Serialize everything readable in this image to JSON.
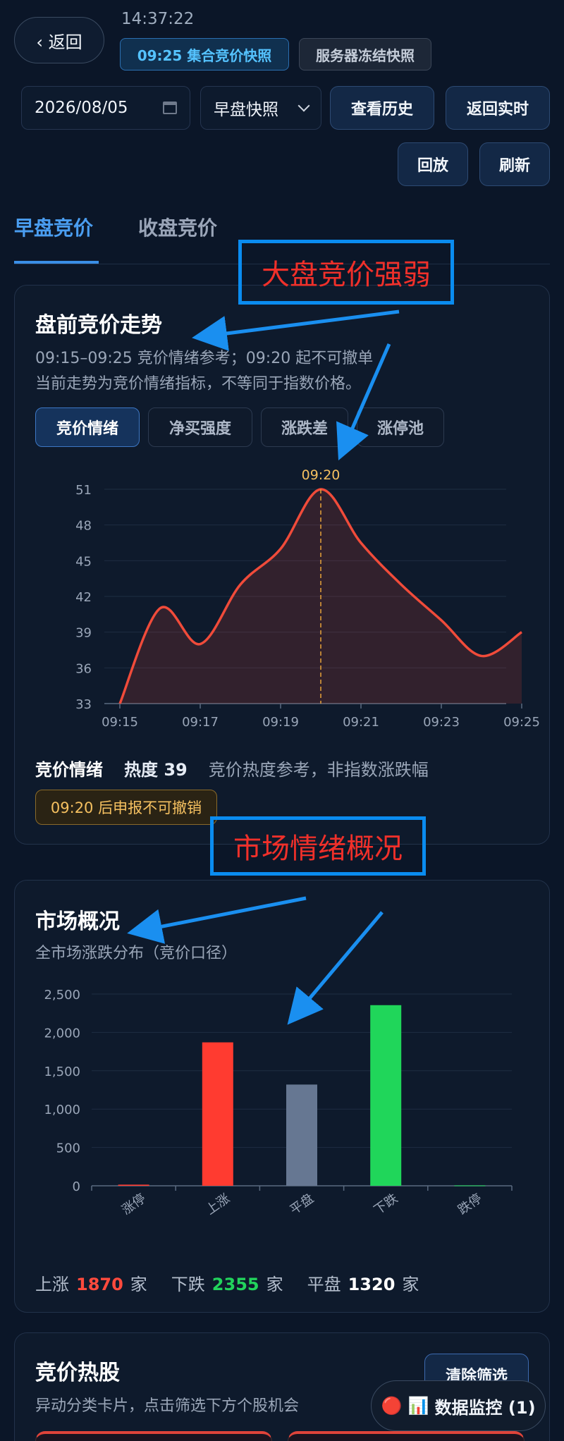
{
  "header": {
    "back_label": "‹ 返回",
    "time": "14:37:22",
    "chip_active": "09:25 集合竞价快照",
    "chip_plain": "服务器冻结快照"
  },
  "controls": {
    "date_value": "2026/08/05",
    "select_value": "早盘快照",
    "history_label": "查看历史",
    "realtime_label": "返回实时",
    "replay_label": "回放",
    "refresh_label": "刷新"
  },
  "tabs": [
    {
      "label": "早盘竞价",
      "active": true
    },
    {
      "label": "收盘竞价",
      "active": false
    }
  ],
  "trend_card": {
    "title": "盘前竞价走势",
    "sub1": "09:15–09:25 竞价情绪参考；09:20 起不可撤单",
    "sub2": "当前走势为竞价情绪指标，不等同于指数价格。",
    "segments": [
      "竞价情绪",
      "净买强度",
      "涨跌差",
      "涨停池"
    ],
    "marker_label": "09:20",
    "legend_name": "竞价情绪",
    "legend_heat": "热度 39",
    "legend_note": "竞价热度参考，非指数涨跌幅",
    "warn": "09:20 后申报不可撤销"
  },
  "market_card": {
    "title": "市场概况",
    "sub": "全市场涨跌分布（竞价口径）",
    "stats_up_label": "上涨",
    "stats_up_value": "1870",
    "stats_down_label": "下跌",
    "stats_down_value": "2355",
    "stats_flat_label": "平盘",
    "stats_flat_value": "1320",
    "unit": "家"
  },
  "hot_card": {
    "title": "竞价热股",
    "sub": "异动分类卡片，点击筛选下方个股机会",
    "clear_label": "清除筛选"
  },
  "annotations": {
    "box1": "大盘竞价强弱",
    "box2": "市场情绪概况"
  },
  "monitor": {
    "label": "数据监控 (1)",
    "icons": "🔴 📊"
  },
  "chart_data": [
    {
      "type": "area",
      "x": [
        "09:15",
        "09:16",
        "09:17",
        "09:18",
        "09:19",
        "09:20",
        "09:21",
        "09:22",
        "09:23",
        "09:24",
        "09:25"
      ],
      "values": [
        33,
        41,
        38,
        43,
        46,
        51,
        46.5,
        43,
        40,
        37,
        39
      ],
      "xticks": [
        "09:15",
        "09:17",
        "09:19",
        "09:21",
        "09:23",
        "09:25"
      ],
      "yticks": [
        33,
        36,
        39,
        42,
        45,
        48,
        51
      ],
      "ylim": [
        33,
        51
      ],
      "color": "#f04b3a",
      "grid": true
    },
    {
      "type": "bar",
      "categories": [
        "涨停",
        "上涨",
        "平盘",
        "下跌",
        "跌停"
      ],
      "values": [
        15,
        1870,
        1320,
        2355,
        5
      ],
      "colors": [
        "#ff3b30",
        "#ff3b30",
        "#667792",
        "#20d65a",
        "#20d65a"
      ],
      "yticks": [
        "0",
        "500",
        "1,000",
        "1,500",
        "2,000",
        "2,500"
      ],
      "ylim": [
        0,
        2500
      ],
      "grid": true
    }
  ]
}
